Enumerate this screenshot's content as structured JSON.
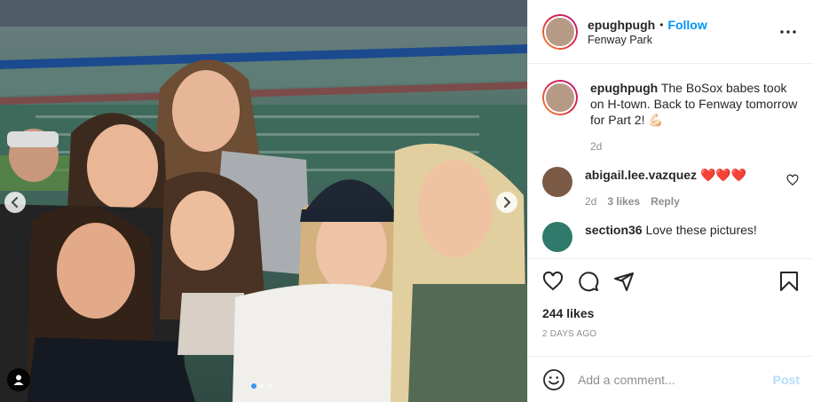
{
  "post": {
    "username": "epughpugh",
    "separator": "•",
    "follow_label": "Follow",
    "location": "Fenway Park",
    "caption": "The BoSox babes took on H-town. Back to Fenway tomorrow for Part 2! 💪🏻",
    "caption_age": "2d",
    "likes": "244 likes",
    "timestamp": "2 DAYS AGO",
    "carousel": {
      "total": 3,
      "active_index": 0
    }
  },
  "comments": [
    {
      "username": "abigail.lee.vazquez",
      "text": "❤️❤️❤️",
      "age": "2d",
      "likes": "3 likes",
      "reply_label": "Reply"
    },
    {
      "username": "section36",
      "text": "Love these pictures!"
    }
  ],
  "composer": {
    "placeholder": "Add a comment...",
    "post_label": "Post"
  },
  "colors": {
    "link": "#0095f6",
    "post_disabled": "#b2dffc",
    "meta": "#8e8e8e",
    "heart": "#ed4956"
  },
  "icons": [
    "chevron-left-icon",
    "chevron-right-icon",
    "user-tag-icon",
    "more-icon",
    "heart-icon",
    "comment-icon",
    "share-icon",
    "bookmark-icon",
    "emoji-icon"
  ]
}
